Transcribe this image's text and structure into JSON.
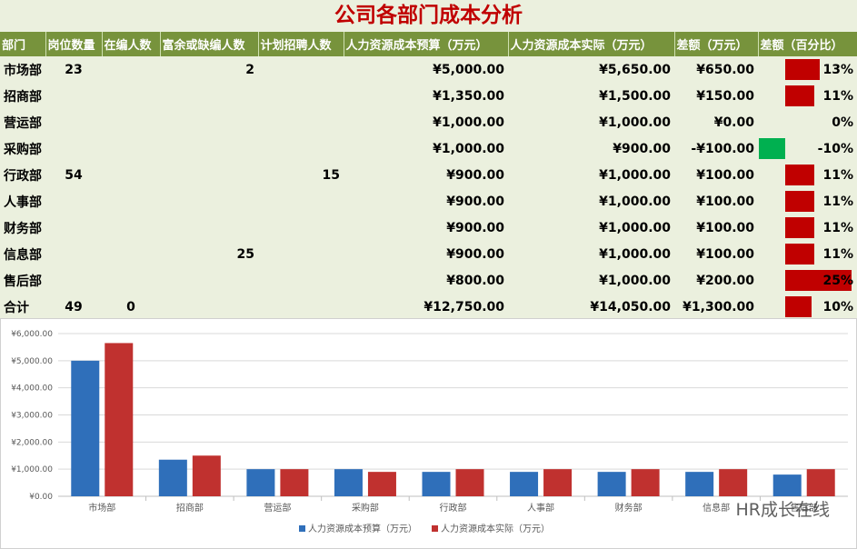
{
  "title": "公司各部门成本分析",
  "table": {
    "headers": [
      "部门",
      "岗位数量",
      "在编人数",
      "富余或缺编人数",
      "计划招聘人数",
      "人力资源成本预算（万元）",
      "人力资源成本实际（万元）",
      "差额（万元）",
      "差额（百分比）"
    ],
    "rows": [
      {
        "dept": "市场部",
        "posts": "23",
        "staff": "",
        "surplus": "2",
        "plan": "",
        "budget": "¥5,000.00",
        "actual": "¥5,650.00",
        "diff": "¥650.00",
        "pct": "13%",
        "pct_value": 0.13
      },
      {
        "dept": "招商部",
        "posts": "",
        "staff": "",
        "surplus": "",
        "plan": "",
        "budget": "¥1,350.00",
        "actual": "¥1,500.00",
        "diff": "¥150.00",
        "pct": "11%",
        "pct_value": 0.11
      },
      {
        "dept": "营运部",
        "posts": "",
        "staff": "",
        "surplus": "",
        "plan": "",
        "budget": "¥1,000.00",
        "actual": "¥1,000.00",
        "diff": "¥0.00",
        "pct": "0%",
        "pct_value": 0
      },
      {
        "dept": "采购部",
        "posts": "",
        "staff": "",
        "surplus": "",
        "plan": "",
        "budget": "¥1,000.00",
        "actual": "¥900.00",
        "diff": "-¥100.00",
        "pct": "-10%",
        "pct_value": -0.1
      },
      {
        "dept": "行政部",
        "posts": "54",
        "staff": "",
        "surplus": "",
        "plan": "15",
        "budget": "¥900.00",
        "actual": "¥1,000.00",
        "diff": "¥100.00",
        "pct": "11%",
        "pct_value": 0.11
      },
      {
        "dept": "人事部",
        "posts": "",
        "staff": "",
        "surplus": "",
        "plan": "",
        "budget": "¥900.00",
        "actual": "¥1,000.00",
        "diff": "¥100.00",
        "pct": "11%",
        "pct_value": 0.11
      },
      {
        "dept": "财务部",
        "posts": "",
        "staff": "",
        "surplus": "",
        "plan": "",
        "budget": "¥900.00",
        "actual": "¥1,000.00",
        "diff": "¥100.00",
        "pct": "11%",
        "pct_value": 0.11
      },
      {
        "dept": "信息部",
        "posts": "",
        "staff": "",
        "surplus": "25",
        "plan": "",
        "budget": "¥900.00",
        "actual": "¥1,000.00",
        "diff": "¥100.00",
        "pct": "11%",
        "pct_value": 0.11
      },
      {
        "dept": "售后部",
        "posts": "",
        "staff": "",
        "surplus": "",
        "plan": "",
        "budget": "¥800.00",
        "actual": "¥1,000.00",
        "diff": "¥200.00",
        "pct": "25%",
        "pct_value": 0.25
      },
      {
        "dept": "合计",
        "posts": "49",
        "staff": "0",
        "surplus": "",
        "plan": "",
        "budget": "¥12,750.00",
        "actual": "¥14,050.00",
        "diff": "¥1,300.00",
        "pct": "10%",
        "pct_value": 0.1
      }
    ]
  },
  "colors": {
    "positive": "#c00000",
    "negative": "#00b050",
    "budget": "#2f6fba",
    "actual": "#c0312f",
    "header": "#77933c",
    "title": "#c00000"
  },
  "chart_data": {
    "type": "bar",
    "categories": [
      "市场部",
      "招商部",
      "营运部",
      "采购部",
      "行政部",
      "人事部",
      "财务部",
      "信息部",
      "售后部"
    ],
    "series": [
      {
        "name": "人力资源成本预算（万元）",
        "values": [
          5000,
          1350,
          1000,
          1000,
          900,
          900,
          900,
          900,
          800
        ]
      },
      {
        "name": "人力资源成本实际（万元）",
        "values": [
          5650,
          1500,
          1000,
          900,
          1000,
          1000,
          1000,
          1000,
          1000
        ]
      }
    ],
    "ylim": [
      0,
      6000
    ],
    "yticks": [
      0,
      1000,
      2000,
      3000,
      4000,
      5000,
      6000
    ],
    "ytick_labels": [
      "¥0.00",
      "¥1,000.00",
      "¥2,000.00",
      "¥3,000.00",
      "¥4,000.00",
      "¥5,000.00",
      "¥6,000.00"
    ],
    "legend": "bottom",
    "grid": true
  },
  "watermark": "HR成长在线"
}
